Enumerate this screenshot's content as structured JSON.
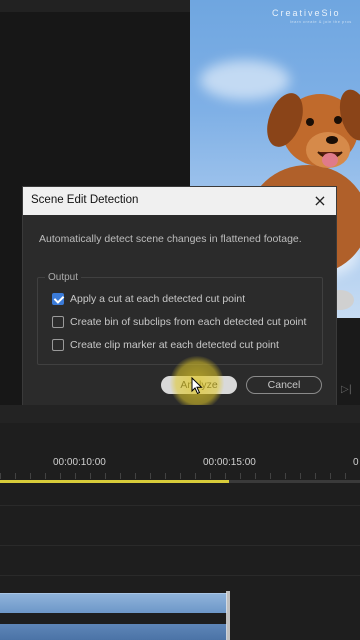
{
  "watermark": {
    "brand": "CreativeSio",
    "tagline": "learn create & join the pros"
  },
  "dialog": {
    "title": "Scene Edit Detection",
    "close_icon": "×",
    "description": "Automatically detect scene changes in flattened footage.",
    "group_label": "Output",
    "options": [
      {
        "label": "Apply a cut at each detected cut point",
        "checked": true
      },
      {
        "label": "Create bin of subclips from each detected cut point",
        "checked": false
      },
      {
        "label": "Create clip marker at each detected cut point",
        "checked": false
      }
    ],
    "analyze_label": "Analyze",
    "cancel_label": "Cancel"
  },
  "timeline": {
    "timecodes": [
      "00:00:10:00",
      "00:00:15:00",
      "0"
    ]
  },
  "icons": {
    "close": "close-icon",
    "cursor": "mouse-pointer-icon",
    "play": "play-step-icon"
  },
  "colors": {
    "accent_check": "#3b7bd8",
    "cursor_highlight": "#e0c828",
    "work_area": "#d8cc3a",
    "clip": "#7aa3d2"
  }
}
